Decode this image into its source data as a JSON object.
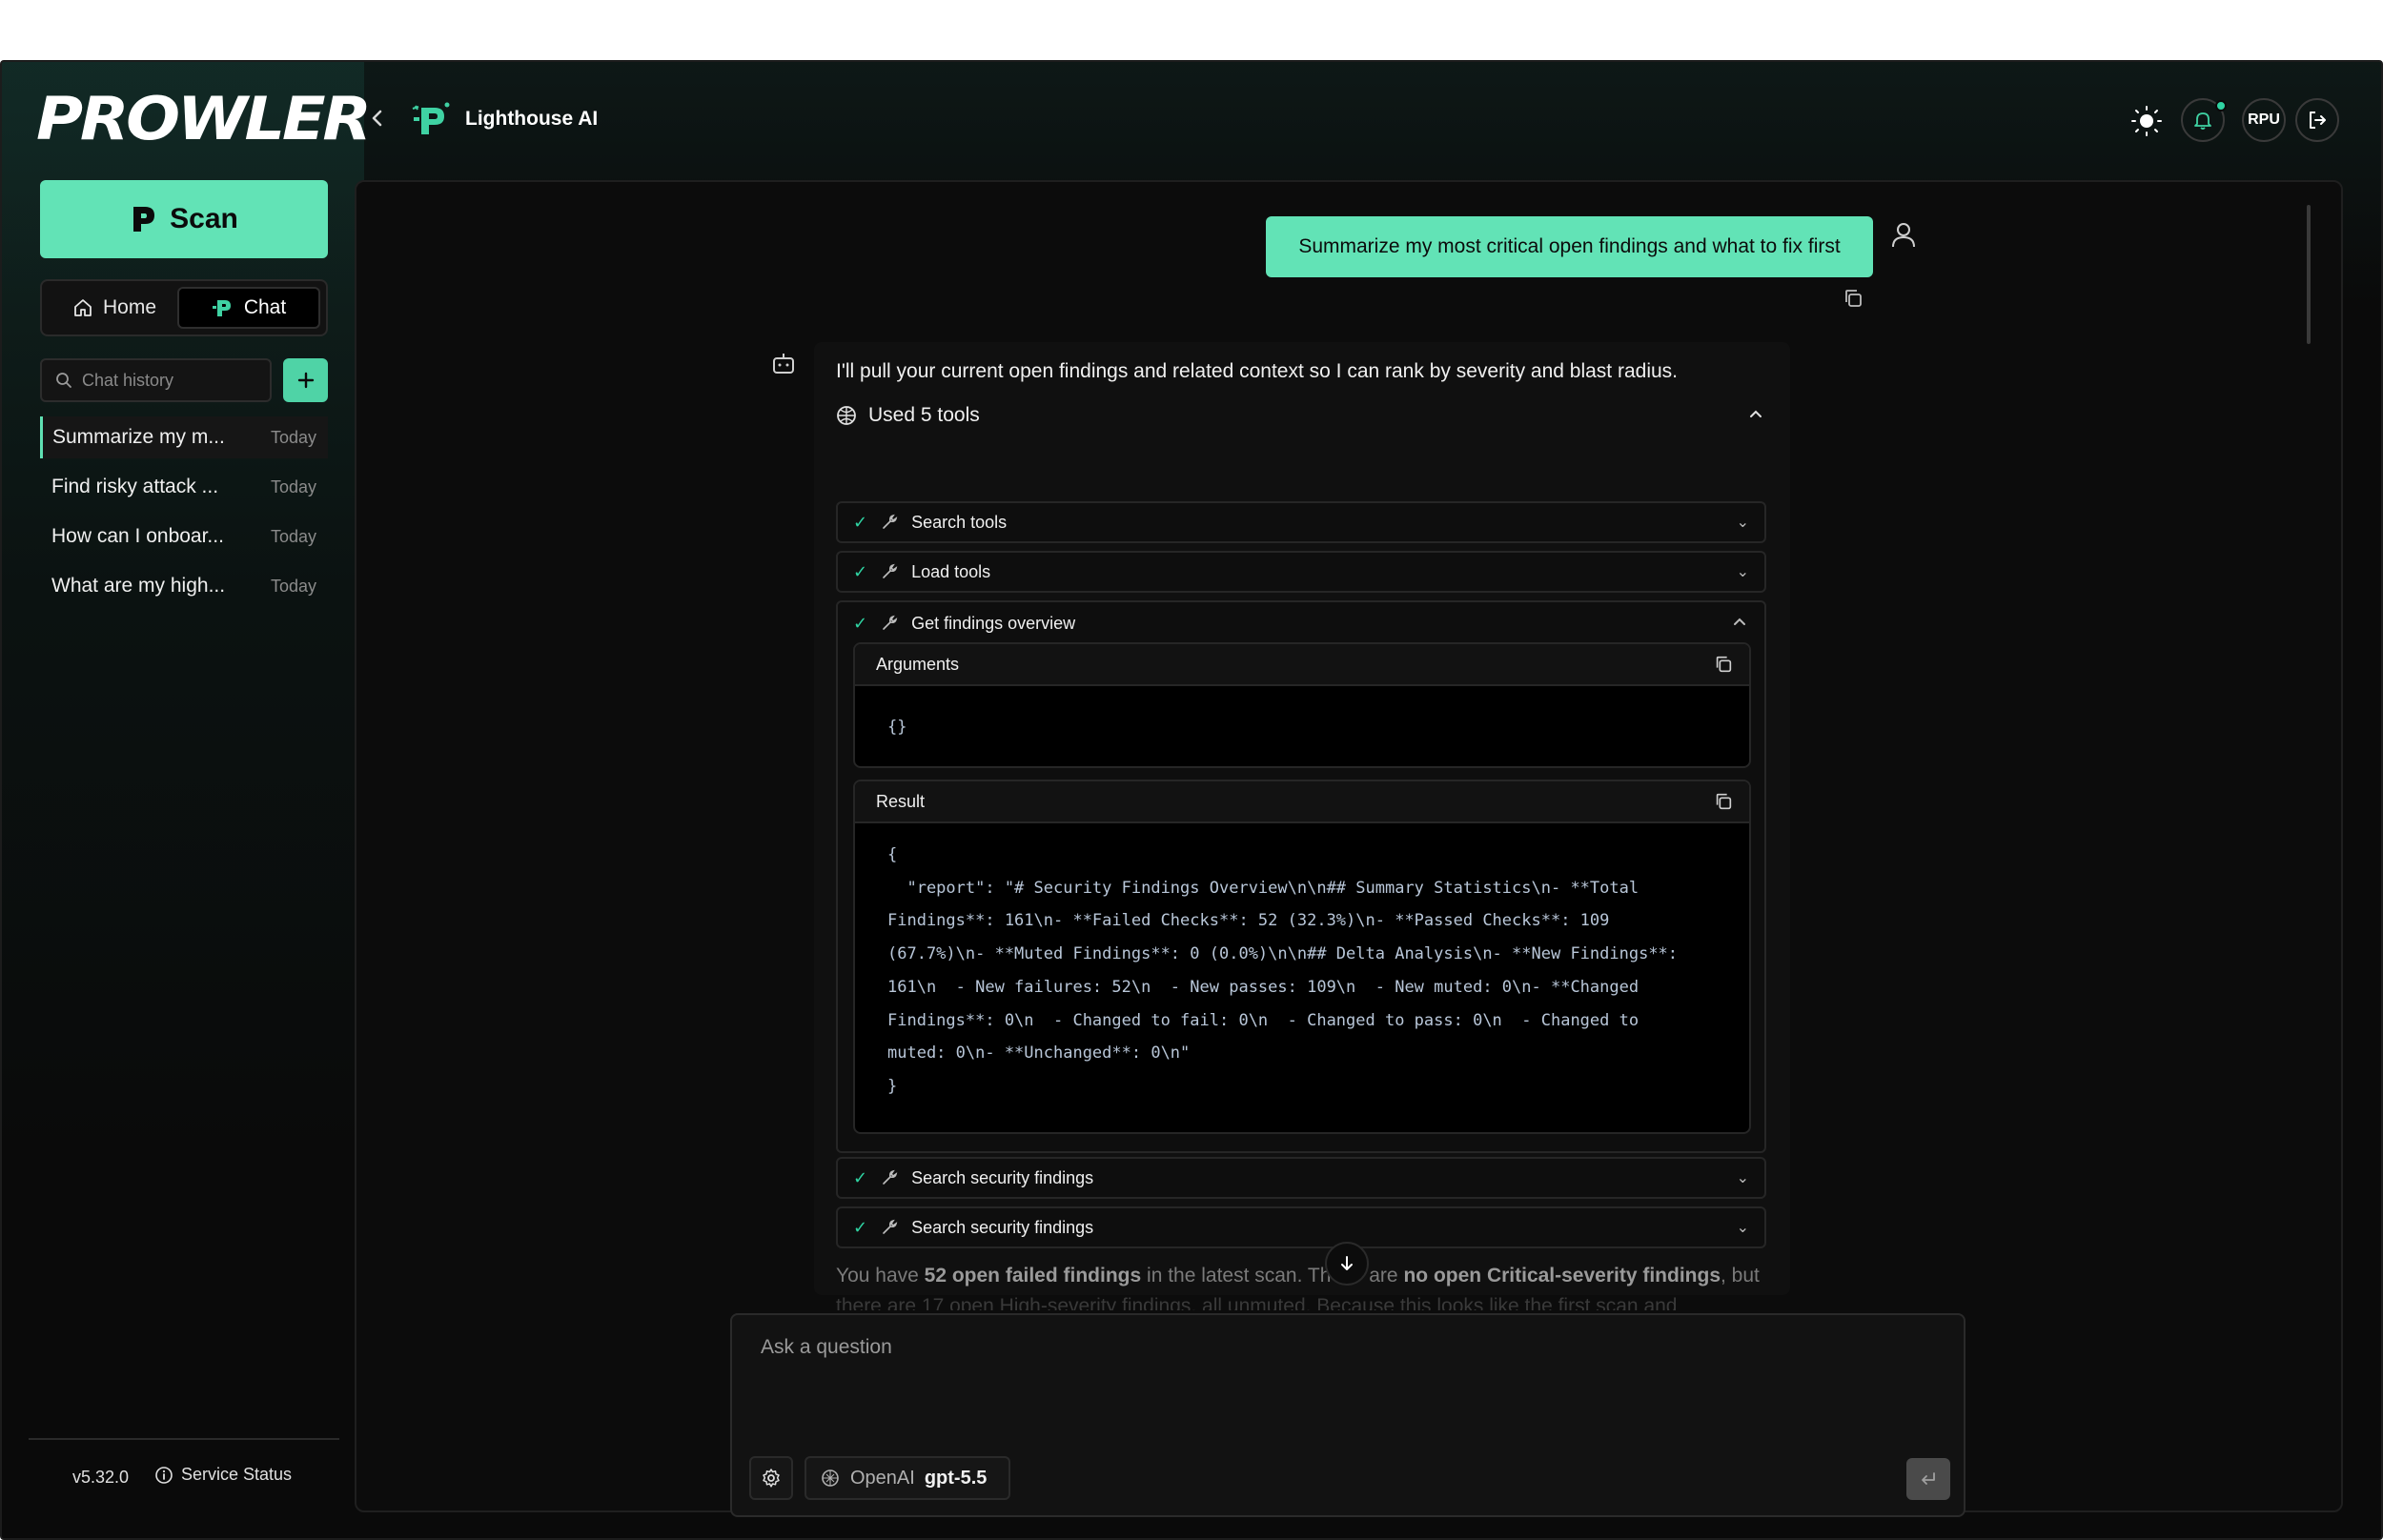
{
  "header": {
    "logo_text": "PROWLER",
    "title": "Lighthouse AI",
    "user_initials": "RPU"
  },
  "sidebar": {
    "scan_label": "Scan",
    "nav_home": "Home",
    "nav_chat": "Chat",
    "history_placeholder": "Chat history",
    "history": [
      {
        "title": "Summarize my m...",
        "date": "Today"
      },
      {
        "title": "Find risky attack ...",
        "date": "Today"
      },
      {
        "title": "How can I onboar...",
        "date": "Today"
      },
      {
        "title": "What are my high...",
        "date": "Today"
      }
    ],
    "version": "v5.32.0",
    "service_status": "Service Status"
  },
  "chat": {
    "user_message": "Summarize my most critical open findings and what to fix first",
    "assistant_intro": "I'll pull your current open findings and related context so I can rank by severity and blast radius.",
    "used_tools_label": "Used 5 tools",
    "tools": [
      {
        "name": "Search tools"
      },
      {
        "name": "Load tools"
      },
      {
        "name": "Get findings overview"
      },
      {
        "name": "Search security findings"
      },
      {
        "name": "Search security findings"
      }
    ],
    "arguments_label": "Arguments",
    "arguments_value": "{}",
    "result_label": "Result",
    "result_lines": [
      "{",
      "  \"report\": \"# Security Findings Overview\\n\\n## Summary Statistics\\n- **Total",
      "Findings**: 161\\n- **Failed Checks**: 52 (32.3%)\\n- **Passed Checks**: 109",
      "(67.7%)\\n- **Muted Findings**: 0 (0.0%)\\n\\n## Delta Analysis\\n- **New Findings**:",
      "161\\n  - New failures: 52\\n  - New passes: 109\\n  - New muted: 0\\n- **Changed",
      "Findings**: 0\\n  - Changed to fail: 0\\n  - Changed to pass: 0\\n  - Changed to",
      "muted: 0\\n- **Unchanged**: 0\\n\"",
      "}"
    ],
    "summary_parts": {
      "p1": "You have ",
      "b1": "52 open failed findings",
      "p2": " in the latest scan. Th",
      "p3": " are ",
      "b2": "no open Critical-severity findings",
      "p4": ", but"
    },
    "summary_line2": "there are 17 open High-severity findings, all unmuted. Because this looks like the first scan and"
  },
  "composer": {
    "placeholder": "Ask a question",
    "provider": "OpenAI",
    "model": "gpt-5.5"
  },
  "colors": {
    "accent": "#62e3b6",
    "background": "#0a0a0a",
    "check": "#2fd3a2"
  }
}
